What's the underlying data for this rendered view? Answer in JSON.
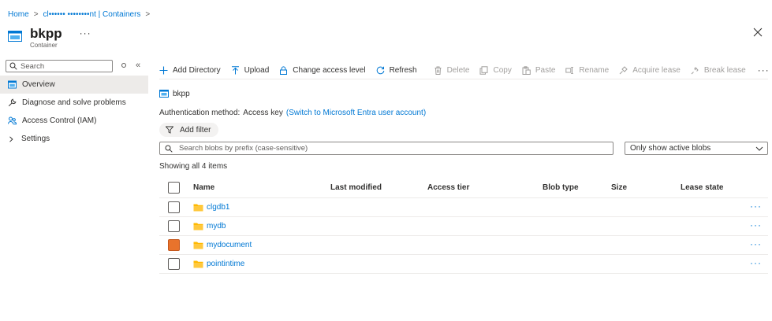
{
  "breadcrumb": {
    "home": "Home",
    "account": "cl••••••  ••••••••nt | Containers"
  },
  "header": {
    "title": "bkpp",
    "subtitle": "Container",
    "more": "···"
  },
  "sidebar": {
    "search_placeholder": "Search",
    "collapse": "«",
    "items": [
      {
        "label": "Overview",
        "icon": "container-icon",
        "active": true
      },
      {
        "label": "Diagnose and solve problems",
        "icon": "wrench-icon"
      },
      {
        "label": "Access Control (IAM)",
        "icon": "people-icon"
      },
      {
        "label": "Settings",
        "icon": "chevron-right-icon"
      }
    ]
  },
  "toolbar": {
    "add_directory": "Add Directory",
    "upload": "Upload",
    "change_access": "Change access level",
    "refresh": "Refresh",
    "delete": "Delete",
    "copy": "Copy",
    "paste": "Paste",
    "rename": "Rename",
    "acquire_lease": "Acquire lease",
    "break_lease": "Break lease",
    "more": "···"
  },
  "content": {
    "path": "bkpp",
    "auth_label": "Authentication method:",
    "auth_value": "Access key",
    "auth_switch": "(Switch to Microsoft Entra user account)",
    "add_filter": "Add filter",
    "search_placeholder": "Search blobs by prefix (case-sensitive)",
    "dropdown_value": "Only show active blobs",
    "showing": "Showing all 4 items"
  },
  "table": {
    "columns": {
      "name": "Name",
      "modified": "Last modified",
      "tier": "Access tier",
      "type": "Blob type",
      "size": "Size",
      "lease": "Lease state"
    },
    "rows": [
      {
        "name": "clgdb1"
      },
      {
        "name": "mydb"
      },
      {
        "name": "mydocument"
      },
      {
        "name": "pointintime"
      }
    ],
    "row_more": "···"
  },
  "colors": {
    "accent": "#0078d4",
    "folder": "#ffb900",
    "selected_checkbox": "#e8732c"
  }
}
